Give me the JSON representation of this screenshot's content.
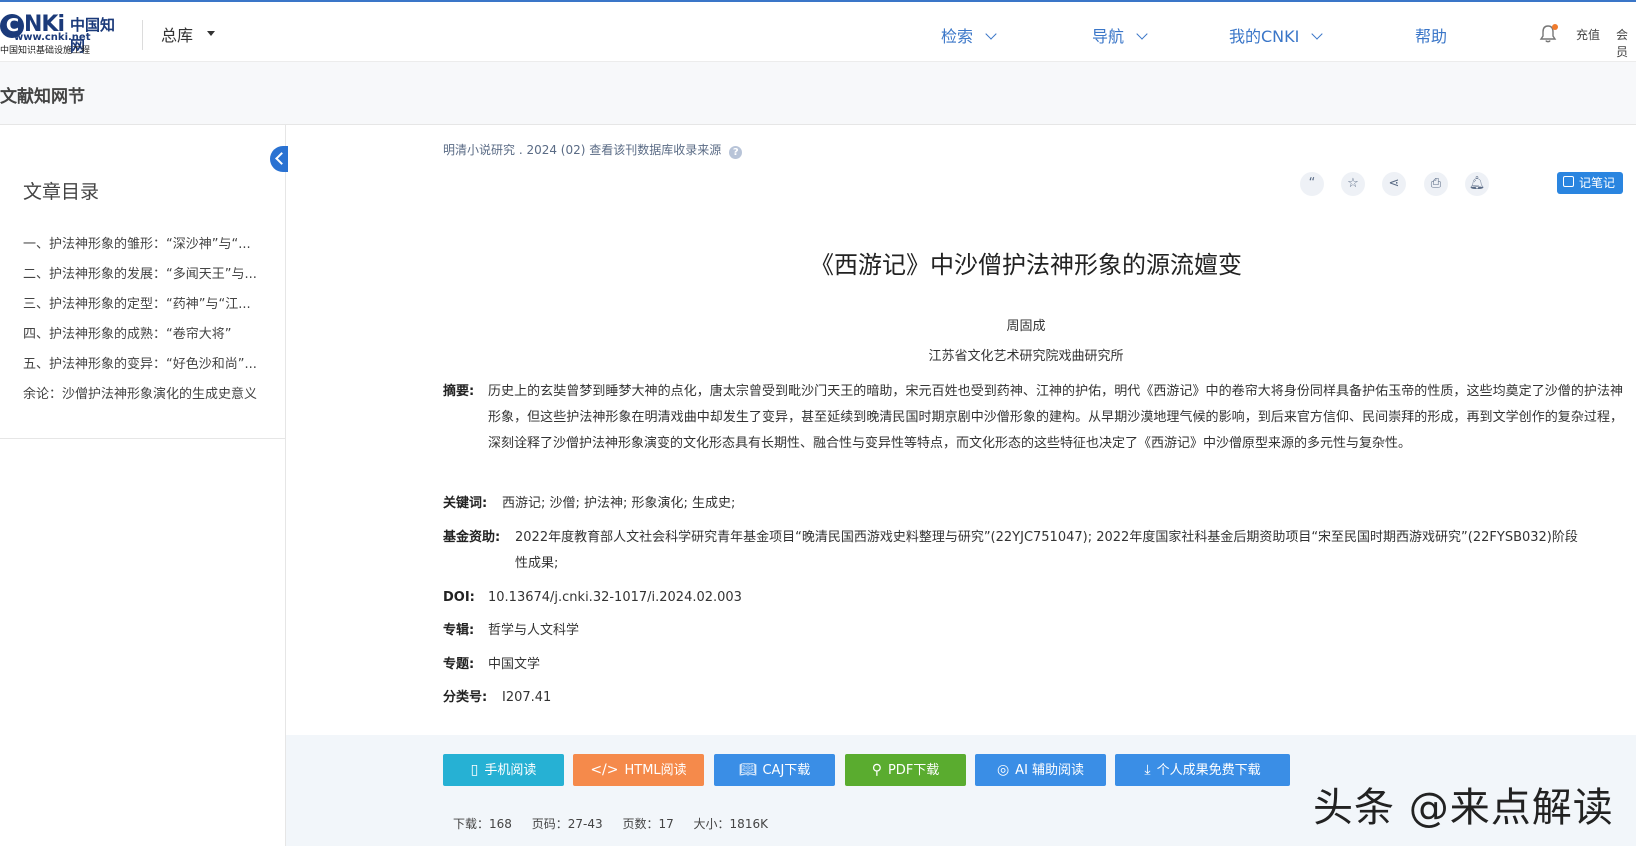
{
  "header": {
    "logo_cnki": "CNKi",
    "logo_cn": "中国知网",
    "logo_url": "www.cnki.net",
    "logo_sub": "中国知识基础设施工程",
    "db_selector": "总库",
    "nav": [
      "检索",
      "导航",
      "我的CNKI",
      "帮助"
    ],
    "recharge": "充值",
    "member": "会员"
  },
  "subheader": {
    "title": "文献知网节"
  },
  "sidebar": {
    "title": "文章目录",
    "items": [
      "一、护法神形象的雏形：“深沙神”与“...",
      "二、护法神形象的发展：“多闻天王”与...",
      "三、护法神形象的定型：“药神”与“江...",
      "四、护法神形象的成熟：“卷帘大将”",
      "五、护法神形象的变异：“好色沙和尚”...",
      "余论：沙僧护法神形象演化的生成史意义"
    ]
  },
  "article": {
    "source": "明清小说研究 . 2024 (02)  查看该刊数据库收录来源",
    "title": "《西游记》中沙僧护法神形象的源流嬗变",
    "author": "周固成",
    "affiliation": "江苏省文化艺术研究院戏曲研究所",
    "abstract_label": "摘要:",
    "abstract": "历史上的玄奘曾梦到睡梦大神的点化，唐太宗曾受到毗沙门天王的暗助，宋元百姓也受到药神、江神的护佑，明代《西游记》中的卷帘大将身份同样具备护佑玉帝的性质，这些均奠定了沙僧的护法神形象，但这些护法神形象在明清戏曲中却发生了变异，甚至延续到晚清民国时期京剧中沙僧形象的建构。从早期沙漠地理气候的影响，到后来官方信仰、民间崇拜的形成，再到文学创作的复杂过程，深刻诠释了沙僧护法神形象演变的文化形态具有长期性、融合性与变异性等特点，而文化形态的这些特征也决定了《西游记》中沙僧原型来源的多元性与复杂性。",
    "keywords_label": "关键词:",
    "keywords": "西游记;  沙僧;  护法神;  形象演化;  生成史;",
    "fund_label": "基金资助:",
    "fund": "2022年度教育部人文社会科学研究青年基金项目“晚清民国西游戏史料整理与研究”(22YJC751047);  2022年度国家社科基金后期资助项目“宋至民国时期西游戏研究”(22FYSB032)阶段性成果;",
    "doi_label": "DOI:",
    "doi": "10.13674/j.cnki.32-1017/i.2024.02.003",
    "series_label": "专辑:",
    "series": "哲学与人文科学",
    "topic_label": "专题:",
    "topic": "中国文学",
    "class_label": "分类号:",
    "class_no": "I207.41"
  },
  "toolbar": {
    "note_button": "记笔记",
    "icons": [
      "quote-icon",
      "star-icon",
      "share-icon",
      "print-icon",
      "bell-icon"
    ]
  },
  "actions": [
    {
      "label": "手机阅读",
      "icon": "phone-icon",
      "color": "#26b1d4"
    },
    {
      "label": "HTML阅读",
      "icon": "code-icon",
      "color": "#f58a4b"
    },
    {
      "label": "CAJ下载",
      "icon": "book-icon",
      "color": "#3a8ee6"
    },
    {
      "label": "PDF下载",
      "icon": "pdf-icon",
      "color": "#5aac2f"
    },
    {
      "label": "AI 辅助阅读",
      "icon": "ai-icon",
      "color": "#3a8ee6"
    },
    {
      "label": "个人成果免费下载",
      "icon": "download-icon",
      "color": "#3a8ee6"
    }
  ],
  "stats": {
    "downloads": "下载：168",
    "pages_range": "页码：27-43",
    "page_count": "页数：17",
    "size": "大小：1816K"
  },
  "watermark": "头条 @来点解读",
  "colors": {
    "brand": "#3a76c8",
    "link": "#3a76c8"
  }
}
